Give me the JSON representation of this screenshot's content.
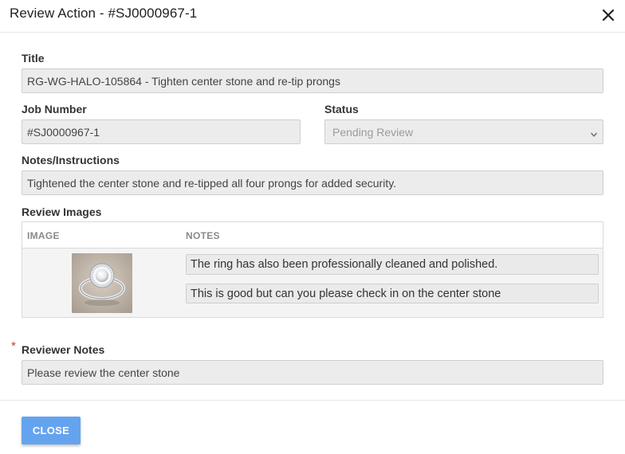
{
  "dialog": {
    "title": "Review Action - #SJ0000967-1"
  },
  "form": {
    "title_label": "Title",
    "title_value": "RG-WG-HALO-105864 - Tighten center stone and re-tip prongs",
    "job_number_label": "Job Number",
    "job_number_value": "#SJ0000967-1",
    "status_label": "Status",
    "status_value": "Pending Review",
    "notes_label": "Notes/Instructions",
    "notes_value": "Tightened the center stone and re-tipped all four prongs for added security.",
    "review_images_label": "Review Images",
    "reviewer_notes_label": "Reviewer Notes",
    "reviewer_notes_value": "Please review the center stone",
    "required_mark": "*"
  },
  "review_images": {
    "columns": [
      "IMAGE",
      "NOTES"
    ],
    "rows": [
      {
        "image": "halo-ring-photo",
        "notes": [
          "The ring has also been professionally cleaned and polished.",
          "This is good but can you please check in on the center stone"
        ]
      }
    ]
  },
  "footer": {
    "close_label": "CLOSE"
  },
  "colors": {
    "accent": "#64a4ef",
    "required": "#d9342b",
    "field_bg": "#ececec"
  }
}
